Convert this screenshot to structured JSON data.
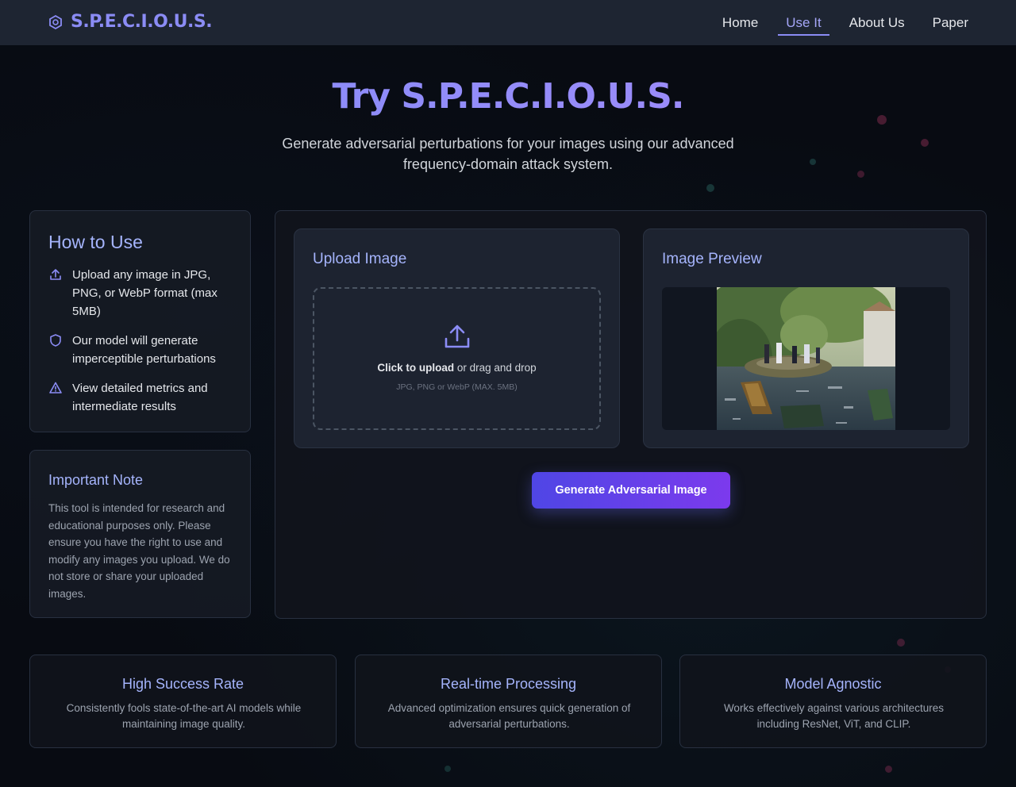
{
  "nav": {
    "brand": "S.P.E.C.I.O.U.S.",
    "links": [
      "Home",
      "Use It",
      "About Us",
      "Paper"
    ],
    "active_link": "Use It"
  },
  "hero": {
    "title": "Try S.P.E.C.I.O.U.S.",
    "subtitle": "Generate adversarial perturbations for your images using our advanced frequency-domain attack system."
  },
  "how_to_use": {
    "title": "How to Use",
    "steps": [
      {
        "icon": "upload-icon",
        "text": "Upload any image in JPG, PNG, or WebP format (max 5MB)"
      },
      {
        "icon": "shield-icon",
        "text": "Our model will generate imperceptible perturbations"
      },
      {
        "icon": "warning-icon",
        "text": "View detailed metrics and intermediate results"
      }
    ]
  },
  "important_note": {
    "title": "Important Note",
    "text": "This tool is intended for research and educational purposes only. Please ensure you have the right to use and modify any images you upload. We do not store or share your uploaded images."
  },
  "upload": {
    "title": "Upload Image",
    "click_text": "Click to upload",
    "drag_text": " or drag and drop",
    "hint": "JPG, PNG or WebP (MAX. 5MB)"
  },
  "preview": {
    "title": "Image Preview"
  },
  "generate_button": "Generate Adversarial Image",
  "features": [
    {
      "title": "High Success Rate",
      "text": "Consistently fools state-of-the-art AI models while maintaining image quality."
    },
    {
      "title": "Real-time Processing",
      "text": "Advanced optimization ensures quick generation of adversarial perturbations."
    },
    {
      "title": "Model Agnostic",
      "text": "Works effectively against various architectures including ResNet, ViT, and CLIP."
    }
  ],
  "colors": {
    "accent": "#8b8cf5",
    "heading": "#a5b4fc",
    "button_start": "#4f46e5",
    "button_end": "#7c3aed",
    "nav_bg": "#1e2532",
    "page_bg": "#080b12"
  }
}
